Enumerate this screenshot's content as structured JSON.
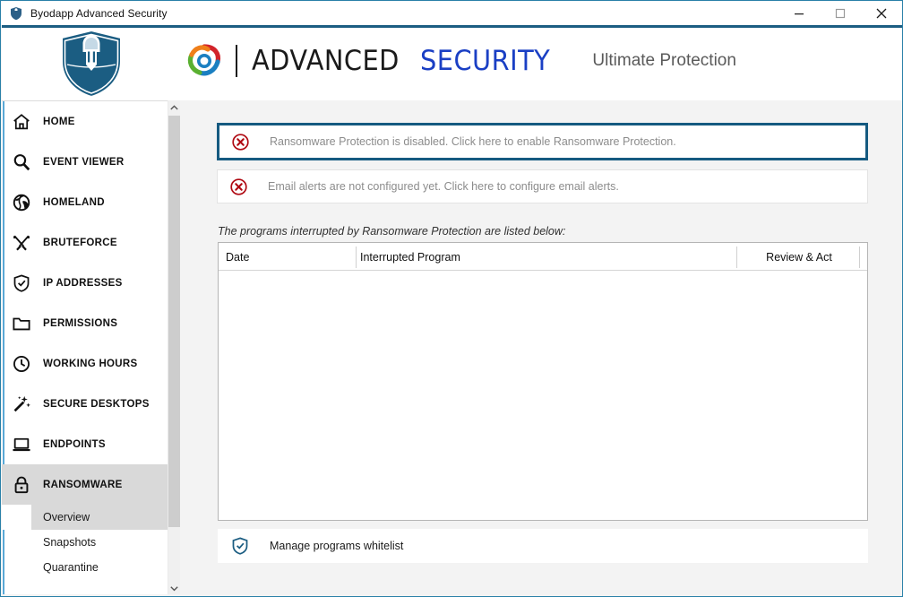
{
  "window": {
    "title": "Byodapp Advanced Security",
    "title_icon": "shield-icon",
    "minimize_label": "Minimize",
    "maximize_label": "Maximize",
    "close_label": "Close"
  },
  "header": {
    "shield_icon": "knight-shield-logo",
    "swirl_icon": "swirl-logo",
    "brand_first": "ADVANCED",
    "brand_second": "SECURITY",
    "tagline": "Ultimate Protection",
    "brand_first_color": "#1a1a1a",
    "brand_second_color": "#1a3fc4",
    "shield_color": "#1b5d82"
  },
  "sidebar": {
    "items": [
      {
        "label": "HOME",
        "icon": "house-icon",
        "active": false
      },
      {
        "label": "EVENT VIEWER",
        "icon": "magnifier-icon",
        "active": false
      },
      {
        "label": "HOMELAND",
        "icon": "globe-icon",
        "active": false
      },
      {
        "label": "BRUTEFORCE",
        "icon": "crossed-swords-icon",
        "active": false
      },
      {
        "label": "IP ADDRESSES",
        "icon": "shield-check-icon",
        "active": false
      },
      {
        "label": "PERMISSIONS",
        "icon": "folder-icon",
        "active": false
      },
      {
        "label": "WORKING HOURS",
        "icon": "clock-icon",
        "active": false
      },
      {
        "label": "SECURE DESKTOPS",
        "icon": "magic-wand-icon",
        "active": false
      },
      {
        "label": "ENDPOINTS",
        "icon": "laptop-icon",
        "active": false
      },
      {
        "label": "RANSOMWARE",
        "icon": "padlock-icon",
        "active": true
      }
    ],
    "subitems": [
      {
        "label": "Overview",
        "selected": true
      },
      {
        "label": "Snapshots",
        "selected": false
      },
      {
        "label": "Quarantine",
        "selected": false
      }
    ],
    "scroll_up_icon": "chevron-up-icon",
    "scroll_down_icon": "chevron-down-icon"
  },
  "main": {
    "alerts": [
      {
        "text": "Ransomware Protection is disabled. Click here to enable Ransomware Protection.",
        "icon": "error-circle-x-icon",
        "highlighted": true
      },
      {
        "text": "Email alerts are not configured yet. Click here to configure email alerts.",
        "icon": "error-circle-x-icon",
        "highlighted": false
      }
    ],
    "list_caption": "The programs interrupted by Ransomware Protection are listed below:",
    "table": {
      "columns": [
        "Date",
        "Interrupted Program",
        "Review & Act"
      ],
      "rows": []
    },
    "footer_action": {
      "label": "Manage programs whitelist",
      "icon": "shield-check-icon"
    }
  },
  "colors": {
    "accent": "#155a80",
    "alert_icon": "#b00b14",
    "brand_blue": "#1a3fc4",
    "window_border": "#2980a8",
    "sidebar_active": "#d9d9d9"
  }
}
